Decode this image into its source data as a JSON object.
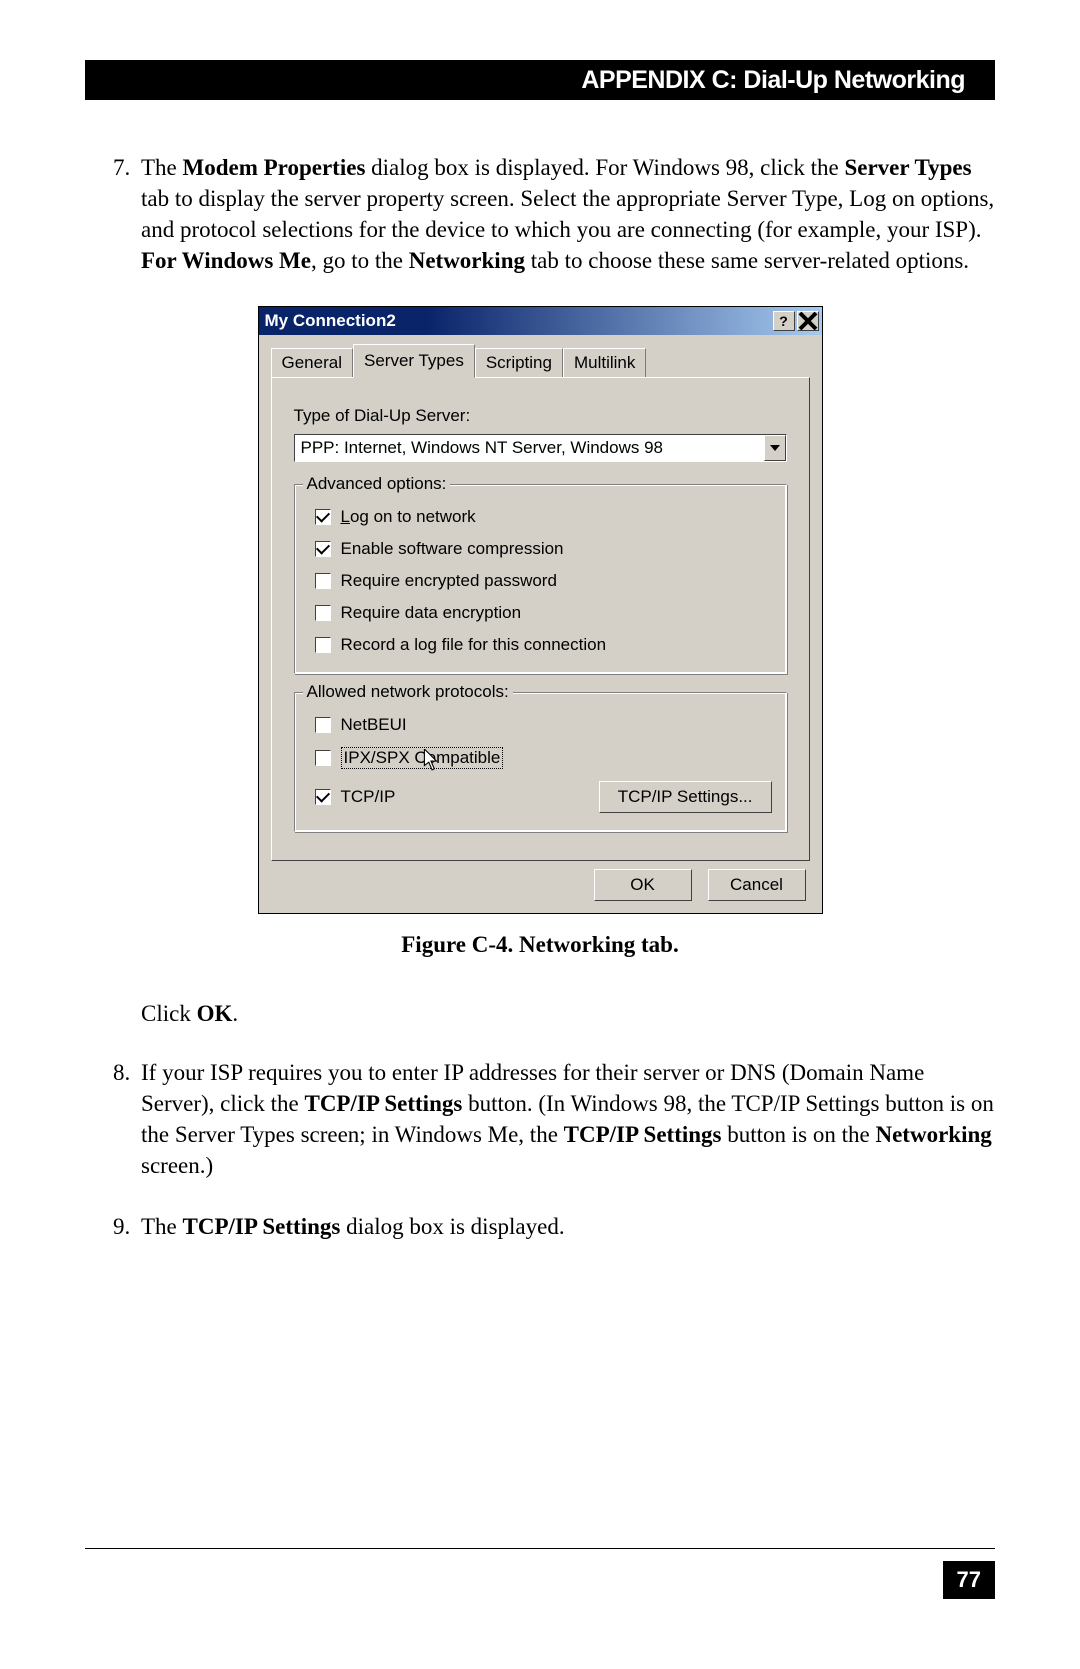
{
  "header": {
    "title": "APPENDIX C: Dial-Up Networking"
  },
  "step7": {
    "number": "7.",
    "t1": "The ",
    "b1": "Modem Properties",
    "t2": " dialog box is displayed. For Windows 98, click the ",
    "b2": "Server Types",
    "t3": " tab to display the server property screen.  Select the appropriate Server Type, Log on options, and protocol selections for the device to which you are connecting (for example, your ISP). ",
    "b3": "For Windows Me",
    "t4": ", go to the ",
    "b4": "Networking",
    "t5": " tab to choose these same server-related options."
  },
  "dialog": {
    "title": "My Connection2",
    "tabs": {
      "general": "General",
      "server_types": "Server Types",
      "scripting": "Scripting",
      "multilink": "Multilink"
    },
    "server_label": "Type of Dial-Up Server:",
    "server_value": "PPP: Internet, Windows NT Server, Windows 98",
    "advanced": {
      "legend": "Advanced options:",
      "logon_u": "L",
      "logon_rest": "og on to network",
      "compress_pre": "Enable software ",
      "compress_u": "c",
      "compress_rest": "ompression",
      "encpw_pre": "Require ",
      "encpw_u": "e",
      "encpw_rest": "ncrypted password",
      "datae_pre": "Require ",
      "datae_u": "d",
      "datae_rest": "ata encryption",
      "record_u": "R",
      "record_rest": "ecord a log file for this connection"
    },
    "protocols": {
      "legend": "Allowed network protocols:",
      "netbeui_u": "N",
      "netbeui_rest": "etBEUI",
      "ipx_u": "I",
      "ipx_rest": "PX/SPX Compatible",
      "tcp_u": "T",
      "tcp_rest": "CP/IP",
      "tcp_settings_pre": "TC",
      "tcp_settings_u": "P",
      "tcp_settings_rest": "/IP Settings..."
    },
    "ok": "OK",
    "cancel": "Cancel"
  },
  "figure_caption": "Figure C-4. Networking tab.",
  "click_ok_pre": "Click ",
  "click_ok_b": "OK",
  "click_ok_post": ".",
  "step8": {
    "number": "8.",
    "t1": "If your ISP requires you to enter IP addresses for their server or DNS (Domain Name Server), click the ",
    "b1": "TCP/IP Settings",
    "t2": " button.  (In Windows 98, the TCP/IP Settings button is on the Server Types screen; in Windows Me, the ",
    "b2": "TCP/IP Settings",
    "t3": " button is on the ",
    "b3": "Networking",
    "t4": " screen.)"
  },
  "step9": {
    "number": "9.",
    "t1": "The ",
    "b1": "TCP/IP Settings",
    "t2": " dialog box is displayed."
  },
  "page_number": "77"
}
